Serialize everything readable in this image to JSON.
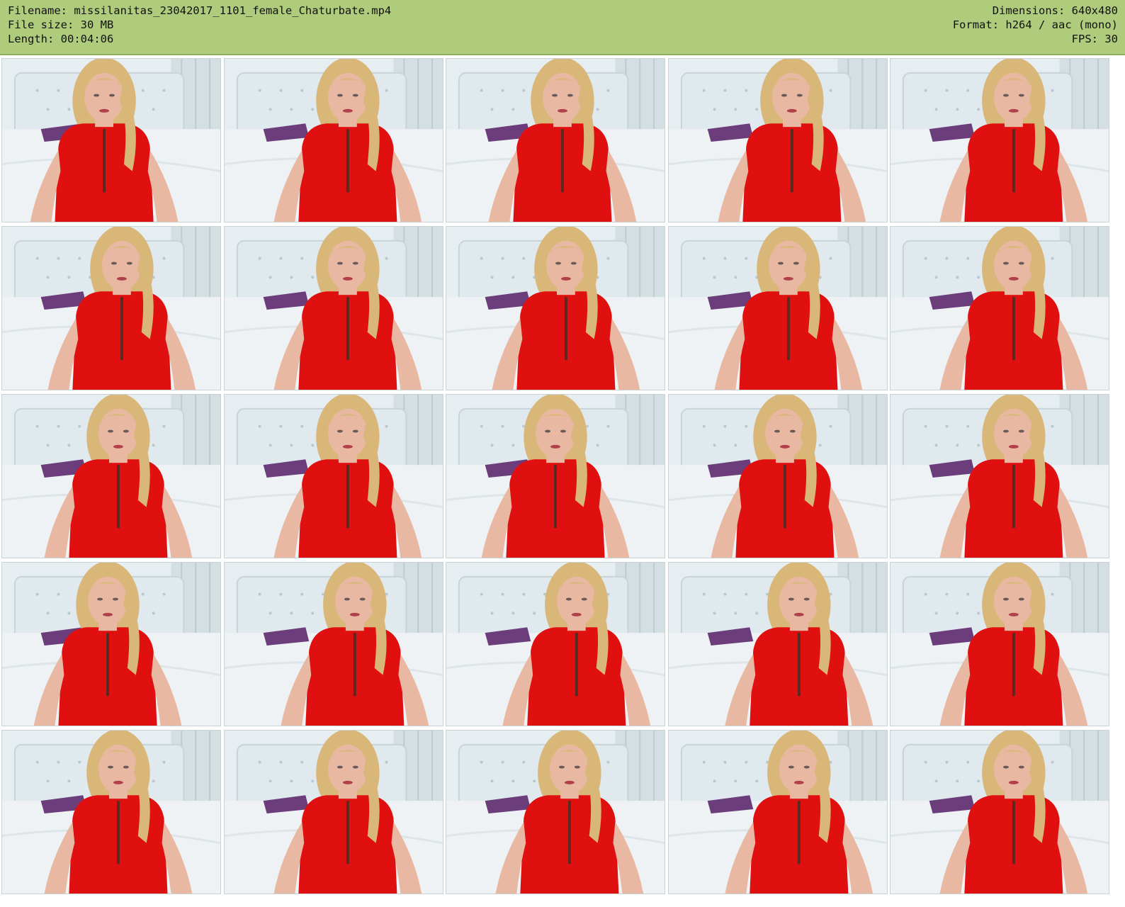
{
  "header": {
    "filename_line": "Filename: missilanitas_23042017_1101_female_Chaturbate.mp4",
    "filesize_line": "File size: 30 MB",
    "length_line": "Length: 00:04:06",
    "dimensions_line": "Dimensions: 640x480",
    "format_line": "Format: h264 / aac (mono)",
    "fps_line": "FPS: 30"
  },
  "colors": {
    "header_bg": "#afcc7c",
    "dress": "#e01010",
    "hair": "#d9b779",
    "skin": "#e9b8a2",
    "headboard": "#dfe9ee",
    "bed": "#eef2f4",
    "pillow": "#6b3d7a"
  },
  "grid": {
    "columns": 5,
    "rows": 5
  }
}
